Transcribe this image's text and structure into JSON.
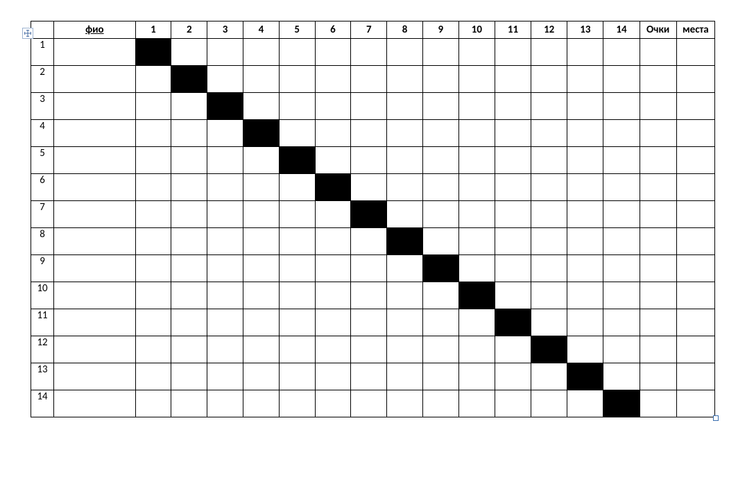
{
  "header": {
    "name_label": "фио",
    "points_label": "Очки",
    "place_label": "места",
    "opponent_numbers": [
      "1",
      "2",
      "3",
      "4",
      "5",
      "6",
      "7",
      "8",
      "9",
      "10",
      "11",
      "12",
      "13",
      "14"
    ]
  },
  "rows": [
    {
      "num": "1"
    },
    {
      "num": "2"
    },
    {
      "num": "3"
    },
    {
      "num": "4"
    },
    {
      "num": "5"
    },
    {
      "num": "6"
    },
    {
      "num": "7"
    },
    {
      "num": "8"
    },
    {
      "num": "9"
    },
    {
      "num": "10"
    },
    {
      "num": "11"
    },
    {
      "num": "12"
    },
    {
      "num": "13"
    },
    {
      "num": "14"
    }
  ]
}
